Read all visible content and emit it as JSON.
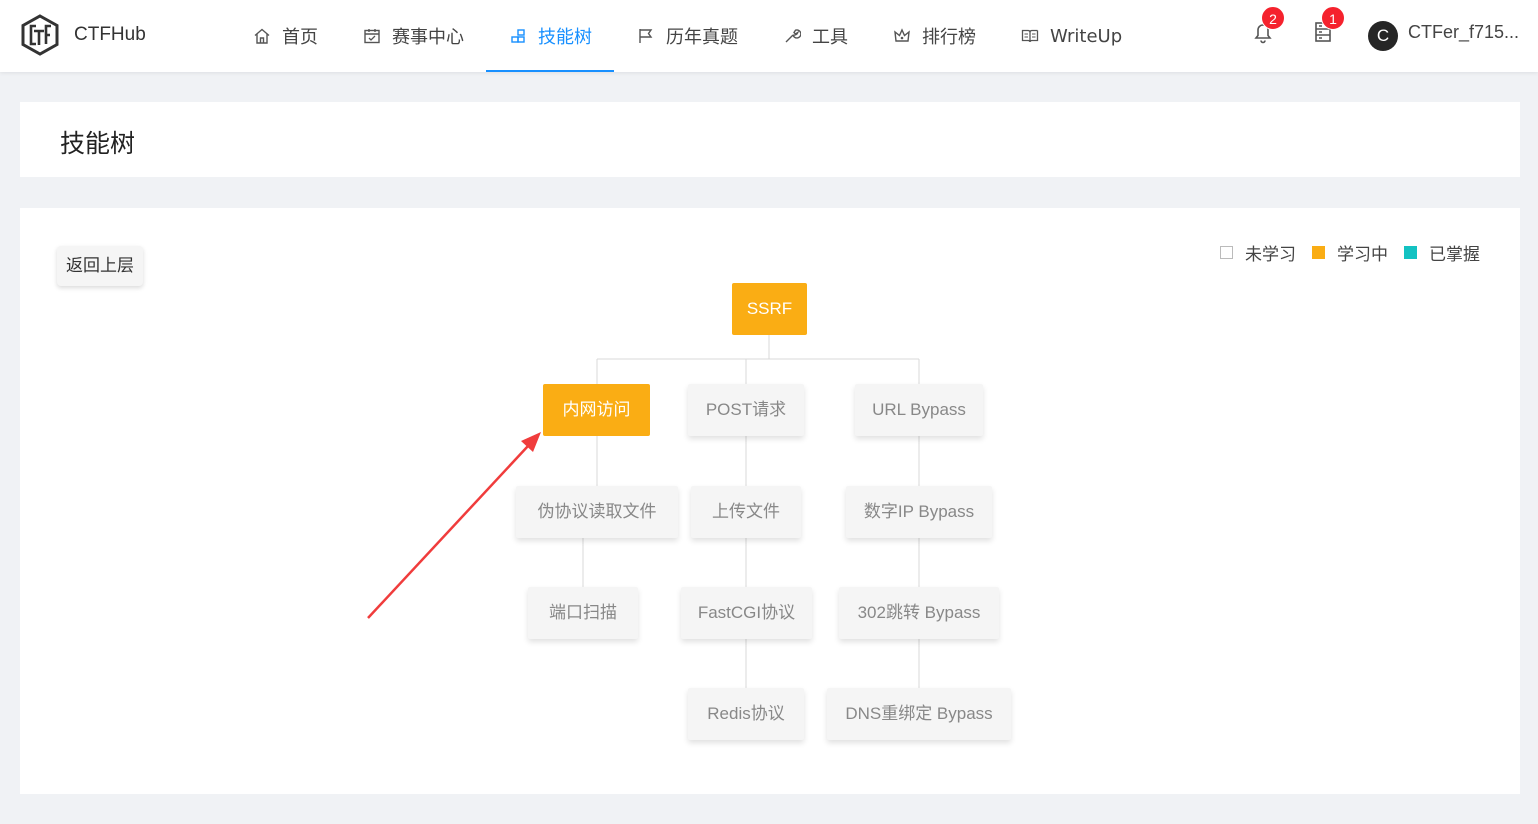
{
  "app": {
    "name": "CTFHub"
  },
  "nav": [
    {
      "label": "首页",
      "icon": "home-icon"
    },
    {
      "label": "赛事中心",
      "icon": "calendar-icon"
    },
    {
      "label": "技能树",
      "icon": "skill-tree-icon",
      "active": true
    },
    {
      "label": "历年真题",
      "icon": "flag-icon"
    },
    {
      "label": "工具",
      "icon": "wrench-icon"
    },
    {
      "label": "排行榜",
      "icon": "crown-icon"
    },
    {
      "label": "WriteUp",
      "icon": "book-icon"
    }
  ],
  "header": {
    "notifications_count": "2",
    "messages_count": "1",
    "avatar_letter": "C",
    "username": "CTFer_f715..."
  },
  "page_title": "技能树",
  "back_button": "返回上层",
  "legend": [
    {
      "label": "未学习",
      "color": "#ffffff"
    },
    {
      "label": "学习中",
      "color": "#faad14"
    },
    {
      "label": "已掌握",
      "color": "#13c2c2"
    }
  ],
  "tree": {
    "root": {
      "label": "SSRF",
      "status": "learning"
    },
    "columns": [
      {
        "nodes": [
          {
            "label": "内网访问",
            "status": "learning"
          },
          {
            "label": "伪协议读取文件",
            "status": "todo"
          },
          {
            "label": "端口扫描",
            "status": "todo"
          }
        ]
      },
      {
        "nodes": [
          {
            "label": "POST请求",
            "status": "todo"
          },
          {
            "label": "上传文件",
            "status": "todo"
          },
          {
            "label": "FastCGI协议",
            "status": "todo"
          },
          {
            "label": "Redis协议",
            "status": "todo"
          }
        ]
      },
      {
        "nodes": [
          {
            "label": "URL Bypass",
            "status": "todo"
          },
          {
            "label": "数字IP Bypass",
            "status": "todo"
          },
          {
            "label": "302跳转 Bypass",
            "status": "todo"
          },
          {
            "label": "DNS重绑定 Bypass",
            "status": "todo"
          }
        ]
      }
    ]
  },
  "colors": {
    "accent": "#1890ff",
    "learning": "#faad14",
    "mastered": "#13c2c2",
    "badge": "#f5222d",
    "annotation_arrow": "#f03c3c"
  }
}
